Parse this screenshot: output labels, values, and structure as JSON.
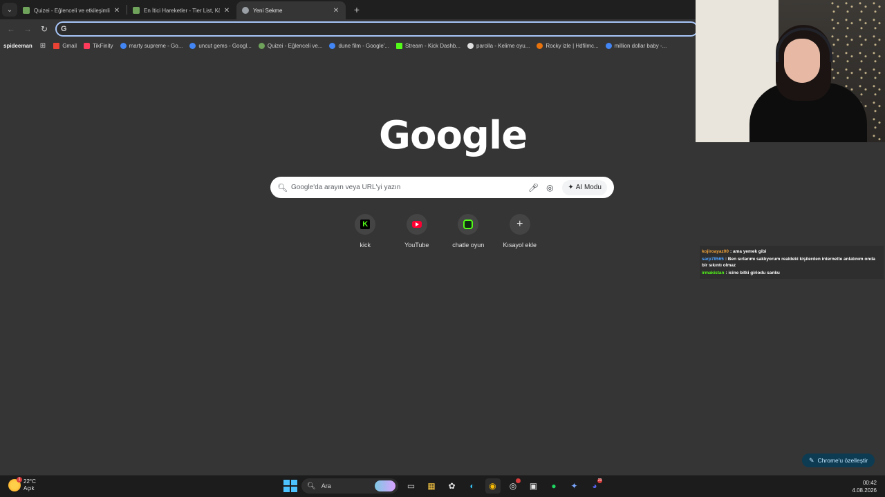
{
  "tabs": [
    {
      "title": "Quizei - Eğlenceli ve etkileşimli",
      "favicon_color": "#6fa35c"
    },
    {
      "title": "En İtici Hareketler - Tier List, Kö",
      "favicon_color": "#6fa35c"
    },
    {
      "title": "Yeni Sekme",
      "favicon_color": "#9aa0a6"
    }
  ],
  "toolbar": {
    "omnibox_value": ""
  },
  "bookmarks": {
    "profile": "spideeman",
    "items": [
      {
        "label": "Gmail",
        "color": "#ea4335"
      },
      {
        "label": "TikFinity",
        "color": "#ff3b5c"
      },
      {
        "label": "marty supreme - Go...",
        "color": "#4285f4"
      },
      {
        "label": "uncut gems - Googl...",
        "color": "#4285f4"
      },
      {
        "label": "Quizei - Eğlenceli ve...",
        "color": "#6fa35c"
      },
      {
        "label": "dune film - Google'...",
        "color": "#4285f4"
      },
      {
        "label": "Stream - Kick Dashb...",
        "color": "#53fc18"
      },
      {
        "label": "parolla - Kelime oyu...",
        "color": "#e0e0e0"
      },
      {
        "label": "Rocky izle | Hdfilmc...",
        "color": "#e8720c"
      },
      {
        "label": "million dollar baby -...",
        "color": "#4285f4"
      }
    ]
  },
  "ntp": {
    "logo": "Google",
    "search_placeholder": "Google'da arayın veya URL'yi yazın",
    "ai_mode_label": "AI Modu",
    "shortcuts": [
      {
        "label": "kick",
        "icon": "kick-icon"
      },
      {
        "label": "YouTube",
        "icon": "youtube-icon"
      },
      {
        "label": "chatle oyun",
        "icon": "chatle-icon"
      },
      {
        "label": "Kısayol ekle",
        "icon": "plus-icon"
      }
    ],
    "customize_label": "Chrome'u özelleştir"
  },
  "chat": [
    {
      "user": "kojiroayaz00",
      "user_color": "#f0a33a",
      "text": ": ama yemek gibi"
    },
    {
      "user": "sarp78565",
      "user_color": "#4fa3ff",
      "text": ": Ben sırlarımı saklıyorum realdeki kişilerden internette anlatınım onda bir sıkıntı olmaz"
    },
    {
      "user": "irmakistan",
      "user_color": "#53fc18",
      "text": ": icine bitki giriodu sanku"
    }
  ],
  "taskbar": {
    "weather_temp": "22°C",
    "weather_desc": "Açık",
    "weather_badge": "1",
    "search_label": "Ara",
    "discord_badge": "23",
    "time": "00:42",
    "date": "4.08.2026"
  }
}
